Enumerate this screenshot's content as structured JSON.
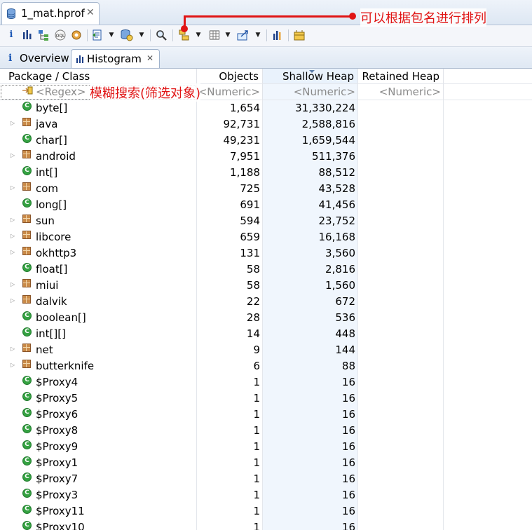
{
  "editor_tab": {
    "title": "1_mat.hprof",
    "close": "✕"
  },
  "view_tabs": [
    {
      "label": "Overview",
      "icon": "i"
    },
    {
      "label": "Histogram",
      "close": "✕"
    }
  ],
  "columns": {
    "name": "Package / Class",
    "objects": "Objects",
    "shallow": "Shallow Heap",
    "retained": "Retained Heap"
  },
  "filters": {
    "name": "<Regex>",
    "objects": "<Numeric>",
    "shallow": "<Numeric>",
    "retained": "<Numeric>"
  },
  "annotations": {
    "group_by_package": "可以根据包名进行排列",
    "fuzzy_search": "模糊搜索(筛选对象)"
  },
  "colors": {
    "annotation": "#e01414",
    "class_icon": "#35a242",
    "package_icon": "#c98a48",
    "sorted_column": "#e9f2fc"
  },
  "rows": [
    {
      "name": "byte[]",
      "kind": "class",
      "objects": "1,654",
      "shallow": "31,330,224"
    },
    {
      "name": "java",
      "kind": "package",
      "objects": "92,731",
      "shallow": "2,588,816"
    },
    {
      "name": "char[]",
      "kind": "class",
      "objects": "49,231",
      "shallow": "1,659,544"
    },
    {
      "name": "android",
      "kind": "package",
      "objects": "7,951",
      "shallow": "511,376"
    },
    {
      "name": "int[]",
      "kind": "class",
      "objects": "1,188",
      "shallow": "88,512"
    },
    {
      "name": "com",
      "kind": "package",
      "objects": "725",
      "shallow": "43,528"
    },
    {
      "name": "long[]",
      "kind": "class",
      "objects": "691",
      "shallow": "41,456"
    },
    {
      "name": "sun",
      "kind": "package",
      "objects": "594",
      "shallow": "23,752"
    },
    {
      "name": "libcore",
      "kind": "package",
      "objects": "659",
      "shallow": "16,168"
    },
    {
      "name": "okhttp3",
      "kind": "package",
      "objects": "131",
      "shallow": "3,560"
    },
    {
      "name": "float[]",
      "kind": "class",
      "objects": "58",
      "shallow": "2,816"
    },
    {
      "name": "miui",
      "kind": "package",
      "objects": "58",
      "shallow": "1,560"
    },
    {
      "name": "dalvik",
      "kind": "package",
      "objects": "22",
      "shallow": "672"
    },
    {
      "name": "boolean[]",
      "kind": "class",
      "objects": "28",
      "shallow": "536"
    },
    {
      "name": "int[][]",
      "kind": "class",
      "objects": "14",
      "shallow": "448"
    },
    {
      "name": "net",
      "kind": "package",
      "objects": "9",
      "shallow": "144"
    },
    {
      "name": "butterknife",
      "kind": "package",
      "objects": "6",
      "shallow": "88"
    },
    {
      "name": "$Proxy4",
      "kind": "class",
      "objects": "1",
      "shallow": "16"
    },
    {
      "name": "$Proxy5",
      "kind": "class",
      "objects": "1",
      "shallow": "16"
    },
    {
      "name": "$Proxy6",
      "kind": "class",
      "objects": "1",
      "shallow": "16"
    },
    {
      "name": "$Proxy8",
      "kind": "class",
      "objects": "1",
      "shallow": "16"
    },
    {
      "name": "$Proxy9",
      "kind": "class",
      "objects": "1",
      "shallow": "16"
    },
    {
      "name": "$Proxy1",
      "kind": "class",
      "objects": "1",
      "shallow": "16"
    },
    {
      "name": "$Proxy7",
      "kind": "class",
      "objects": "1",
      "shallow": "16"
    },
    {
      "name": "$Proxy3",
      "kind": "class",
      "objects": "1",
      "shallow": "16"
    },
    {
      "name": "$Proxy11",
      "kind": "class",
      "objects": "1",
      "shallow": "16"
    },
    {
      "name": "$Proxy10",
      "kind": "class",
      "objects": "1",
      "shallow": "16"
    }
  ]
}
